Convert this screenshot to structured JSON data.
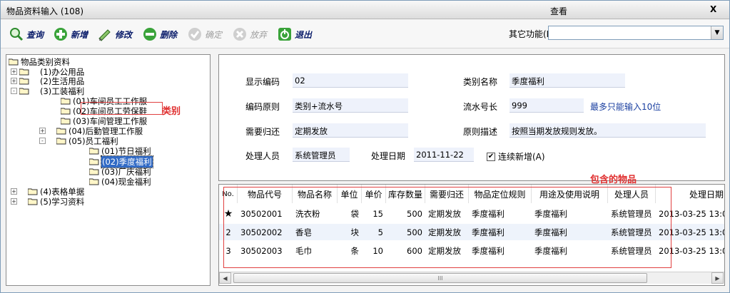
{
  "window": {
    "title": "物品资料输入 (108)",
    "mode": "查看",
    "close": "X"
  },
  "toolbar": {
    "buttons": [
      {
        "label": "查询",
        "icon": "search-icon",
        "enabled": true
      },
      {
        "label": "新增",
        "icon": "add-icon",
        "enabled": true
      },
      {
        "label": "修改",
        "icon": "edit-icon",
        "enabled": true
      },
      {
        "label": "删除",
        "icon": "delete-icon",
        "enabled": true
      },
      {
        "label": "确定",
        "icon": "confirm-icon",
        "enabled": false
      },
      {
        "label": "放弃",
        "icon": "discard-icon",
        "enabled": false
      },
      {
        "label": "退出",
        "icon": "exit-icon",
        "enabled": true
      }
    ],
    "other_functions_label": "其它功能(I)",
    "other_functions_value": ""
  },
  "tree": {
    "root": "物品类别资料",
    "nodes": [
      {
        "label": "(1)办公用品"
      },
      {
        "label": "(2)生活用品"
      },
      {
        "label": "(3)工装福利"
      },
      {
        "label": "(01)车间员工工作服"
      },
      {
        "label": "(02)车间员工劳保鞋"
      },
      {
        "label": "(03)车间管理工作服"
      },
      {
        "label": "(04)后勤管理工作服"
      },
      {
        "label": "(05)员工福利"
      },
      {
        "label": "(01)节日福利"
      },
      {
        "label": "(02)季度福利"
      },
      {
        "label": "(03)厂庆福利"
      },
      {
        "label": "(04)现金福利"
      },
      {
        "label": "(4)表格单据"
      },
      {
        "label": "(5)学习资料"
      }
    ],
    "annotation": "类别"
  },
  "detail": {
    "display_code_label": "显示编码",
    "display_code": "02",
    "category_name_label": "类别名称",
    "category_name": "季度福利",
    "code_rule_label": "编码原则",
    "code_rule": "类别+流水号",
    "serial_length_label": "流水号长",
    "serial_length": "999",
    "serial_note": "最多只能输入10位",
    "belongs_label": "需要归还",
    "belongs": "定期发放",
    "rule_desc_label": "原则描述",
    "rule_desc": "按照当期发放规则发放。",
    "handler_label": "处理人员",
    "handler": "系统管理员",
    "date_label": "处理日期",
    "date": "2011-11-22",
    "continuous_add_label": "连续新增(A)",
    "continuous_add": true
  },
  "grid": {
    "annotation": "包含的物品",
    "columns": [
      "No.",
      "物品代号",
      "物品名称",
      "单位",
      "单价",
      "库存数量",
      "需要归还",
      "物品定位规则",
      "用途及使用说明",
      "处理人员",
      "处理日期"
    ],
    "rows": [
      {
        "no": "★",
        "code": "30502001",
        "name": "洗衣粉",
        "unit": "袋",
        "price": "15",
        "stock": "500",
        "return": "定期发放",
        "rule": "季度福利",
        "usage": "季度福利",
        "handler": "系统管理员",
        "date": "2013-03-25 13:0"
      },
      {
        "no": "2",
        "code": "30502002",
        "name": "香皂",
        "unit": "块",
        "price": "5",
        "stock": "500",
        "return": "定期发放",
        "rule": "季度福利",
        "usage": "季度福利",
        "handler": "系统管理员",
        "date": "2013-03-25 13:0"
      },
      {
        "no": "3",
        "code": "30502003",
        "name": "毛巾",
        "unit": "条",
        "price": "10",
        "stock": "600",
        "return": "定期发放",
        "rule": "季度福利",
        "usage": "季度福利",
        "handler": "系统管理员",
        "date": "2013-03-25 13:0"
      }
    ],
    "scroll_thumb": "III"
  }
}
